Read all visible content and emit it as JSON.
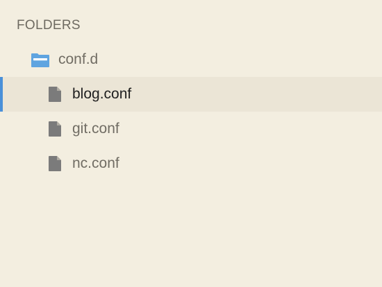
{
  "sidebar": {
    "section_title": "FOLDERS",
    "folder": {
      "label": "conf.d",
      "icon": "folder-icon",
      "icon_color": "#5fa4e0"
    },
    "files": [
      {
        "label": "blog.conf",
        "icon": "file-icon",
        "selected": true
      },
      {
        "label": "git.conf",
        "icon": "file-icon",
        "selected": false
      },
      {
        "label": "nc.conf",
        "icon": "file-icon",
        "selected": false
      }
    ]
  },
  "colors": {
    "background": "#f3eee0",
    "selected_row": "#ebe5d6",
    "selection_accent": "#4a90d9",
    "file_icon": "#7b7b7b"
  }
}
